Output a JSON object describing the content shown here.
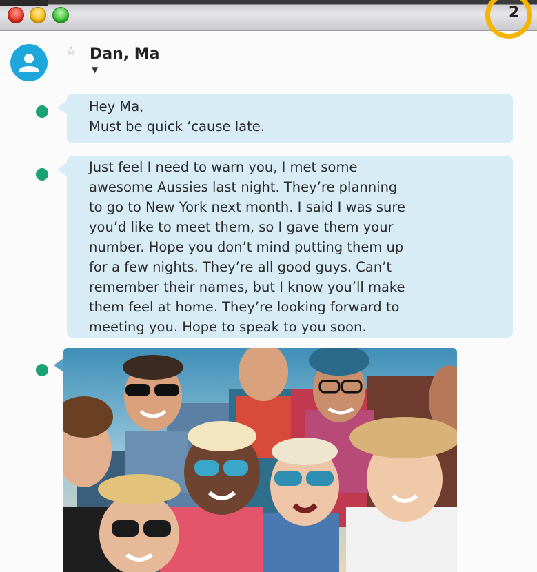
{
  "window": {
    "badge_count": "2",
    "controls": [
      "close",
      "minimize",
      "zoom"
    ]
  },
  "conversation": {
    "contact_name": "Dan, Ma",
    "avatar_icon": "person-icon",
    "favorite_icon": "star-outline-icon",
    "expand_icon": "triangle-down-icon"
  },
  "messages": [
    {
      "lines": [
        "Hey Ma,",
        "Must be quick ‘cause late."
      ]
    },
    {
      "lines": [
        "Just feel I need to warn you, I met some",
        "awesome Aussies last night. They’re planning",
        "to go to New York next month. I said I was sure",
        "you’d like to meet them, so I gave them your",
        "number. Hope you don’t mind putting them up",
        "for a few nights. They’re all good guys. Can’t",
        "remember their names, but I know you’ll make",
        "them feel at home. They’re looking forward to",
        "meeting you. Hope to speak to you soon."
      ]
    },
    {
      "attachment": "photo of a group of friends wearing sunglasses"
    }
  ],
  "colors": {
    "bubble": "#d7ecf5",
    "marker": "#1aa372",
    "avatar": "#1da7db",
    "badge_ring": "#f5b400"
  }
}
